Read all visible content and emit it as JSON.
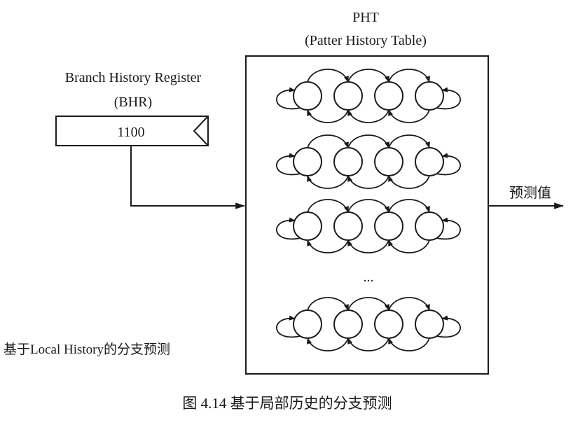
{
  "pht": {
    "title": "PHT",
    "subtitle": "(Patter History Table)",
    "visible_rows": 4,
    "ellipsis": "...",
    "states_per_row": 4
  },
  "bhr": {
    "label_line1": "Branch History Register",
    "label_line2": "(BHR)",
    "value": "1100"
  },
  "output_label": "预测值",
  "side_label": "基于Local History的分支预测",
  "caption": "图 4.14   基于局部历史的分支预测"
}
